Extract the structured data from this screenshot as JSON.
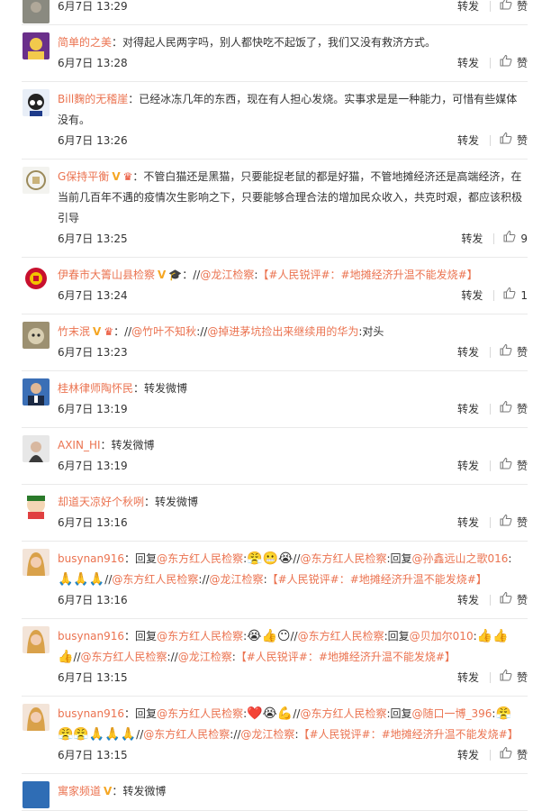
{
  "actions": {
    "repost": "转发",
    "like": "赞"
  },
  "comments": [
    {
      "user": "",
      "badges": [],
      "segments": [
        {
          "t": "text",
          "v": ""
        }
      ],
      "time": "6月7日 13:29",
      "likes": "赞",
      "avatar": "gray"
    },
    {
      "user": "简单的之美",
      "badges": [],
      "segments": [
        {
          "t": "text",
          "v": "：对得起人民两字吗，别人都快吃不起饭了，我们又没有救济方式。"
        }
      ],
      "time": "6月7日 13:28",
      "likes": "赞",
      "avatar": "purple"
    },
    {
      "user": "Bill麴的无稽崖",
      "badges": [],
      "segments": [
        {
          "t": "text",
          "v": "：已经冰冻几年的东西，现在有人担心发烧。实事求是是一种能力，可惜有些媒体没有。"
        }
      ],
      "time": "6月7日 13:26",
      "likes": "赞",
      "avatar": "anime"
    },
    {
      "user": "G保持平衡",
      "badges": [
        "V",
        "vip"
      ],
      "segments": [
        {
          "t": "text",
          "v": "：不管白猫还是黑猫，只要能捉老鼠的都是好猫，不管地摊经济还是高端经济，在当前几百年不遇的疫情次生影响之下，只要能够合理合法的增加民众收入，共克时艰，都应该积极引导"
        }
      ],
      "time": "6月7日 13:25",
      "likes": "9",
      "avatar": "logo"
    },
    {
      "user": "伊春市大箐山县检察",
      "badges": [
        "V",
        "grad"
      ],
      "segments": [
        {
          "t": "text",
          "v": "：//"
        },
        {
          "t": "link",
          "v": "@龙江检察"
        },
        {
          "t": "text",
          "v": ":"
        },
        {
          "t": "link",
          "v": "【#人民锐评#：#地摊经济升温不能发烧#】"
        }
      ],
      "time": "6月7日 13:24",
      "likes": "1",
      "avatar": "emblem"
    },
    {
      "user": "竹末泯",
      "badges": [
        "V",
        "vip"
      ],
      "segments": [
        {
          "t": "text",
          "v": "：//"
        },
        {
          "t": "link",
          "v": "@竹叶不知秋"
        },
        {
          "t": "text",
          "v": "://"
        },
        {
          "t": "link",
          "v": "@掉进茅坑捡出来继续用的华为"
        },
        {
          "t": "text",
          "v": ":对头"
        }
      ],
      "time": "6月7日 13:23",
      "likes": "赞",
      "avatar": "cat"
    },
    {
      "user": "桂林律师陶怀民",
      "badges": [],
      "segments": [
        {
          "t": "text",
          "v": "：转发微博"
        }
      ],
      "time": "6月7日 13:19",
      "likes": "赞",
      "avatar": "man"
    },
    {
      "user": "AXIN_HI",
      "badges": [],
      "segments": [
        {
          "t": "text",
          "v": "：转发微博"
        }
      ],
      "time": "6月7日 13:19",
      "likes": "赞",
      "avatar": "girl"
    },
    {
      "user": "却道天凉好个秋咧",
      "badges": [],
      "segments": [
        {
          "t": "text",
          "v": "：转发微博"
        }
      ],
      "time": "6月7日 13:16",
      "likes": "赞",
      "avatar": "cartoon"
    },
    {
      "user": "busynan916",
      "badges": [],
      "segments": [
        {
          "t": "text",
          "v": "：回复"
        },
        {
          "t": "link",
          "v": "@东方红人民检察"
        },
        {
          "t": "text",
          "v": ":"
        },
        {
          "t": "emo",
          "v": "😤😬😭"
        },
        {
          "t": "text",
          "v": "//"
        },
        {
          "t": "link",
          "v": "@东方红人民检察"
        },
        {
          "t": "text",
          "v": ":回复"
        },
        {
          "t": "link",
          "v": "@孙鑫远山之歌016"
        },
        {
          "t": "text",
          "v": ":"
        },
        {
          "t": "emo",
          "v": "🙏🙏🙏"
        },
        {
          "t": "text",
          "v": "//"
        },
        {
          "t": "link",
          "v": "@东方红人民检察"
        },
        {
          "t": "text",
          "v": "://"
        },
        {
          "t": "link",
          "v": "@龙江检察"
        },
        {
          "t": "text",
          "v": ":"
        },
        {
          "t": "link",
          "v": "【#人民锐评#：#地摊经济升温不能发烧#】"
        }
      ],
      "time": "6月7日 13:16",
      "likes": "赞",
      "avatar": "woman"
    },
    {
      "user": "busynan916",
      "badges": [],
      "segments": [
        {
          "t": "text",
          "v": "：回复"
        },
        {
          "t": "link",
          "v": "@东方红人民检察"
        },
        {
          "t": "text",
          "v": ":"
        },
        {
          "t": "emo",
          "v": "😭👍😶"
        },
        {
          "t": "text",
          "v": "//"
        },
        {
          "t": "link",
          "v": "@东方红人民检察"
        },
        {
          "t": "text",
          "v": ":回复"
        },
        {
          "t": "link",
          "v": "@贝加尔010"
        },
        {
          "t": "text",
          "v": ":"
        },
        {
          "t": "emo",
          "v": "👍👍👍"
        },
        {
          "t": "text",
          "v": "//"
        },
        {
          "t": "link",
          "v": "@东方红人民检察"
        },
        {
          "t": "text",
          "v": "://"
        },
        {
          "t": "link",
          "v": "@龙江检察"
        },
        {
          "t": "text",
          "v": ":"
        },
        {
          "t": "link",
          "v": "【#人民锐评#：#地摊经济升温不能发烧#】"
        }
      ],
      "time": "6月7日 13:15",
      "likes": "赞",
      "avatar": "woman"
    },
    {
      "user": "busynan916",
      "badges": [],
      "segments": [
        {
          "t": "text",
          "v": "：回复"
        },
        {
          "t": "link",
          "v": "@东方红人民检察"
        },
        {
          "t": "text",
          "v": ":"
        },
        {
          "t": "emo",
          "v": "❤️😭💪"
        },
        {
          "t": "text",
          "v": "//"
        },
        {
          "t": "link",
          "v": "@东方红人民检察"
        },
        {
          "t": "text",
          "v": ":回复"
        },
        {
          "t": "link",
          "v": "@随口一博_396"
        },
        {
          "t": "text",
          "v": ":"
        },
        {
          "t": "emo",
          "v": "😤😤😤🙏🙏🙏"
        },
        {
          "t": "text",
          "v": "//"
        },
        {
          "t": "link",
          "v": "@东方红人民检察"
        },
        {
          "t": "text",
          "v": "://"
        },
        {
          "t": "link",
          "v": "@龙江检察"
        },
        {
          "t": "text",
          "v": ":"
        },
        {
          "t": "link",
          "v": "【#人民锐评#：#地摊经济升温不能发烧#】"
        }
      ],
      "time": "6月7日 13:15",
      "likes": "赞",
      "avatar": "woman"
    },
    {
      "user": "寓家频道",
      "badges": [
        "V"
      ],
      "segments": [
        {
          "t": "text",
          "v": "：转发微博"
        }
      ],
      "time": "",
      "likes": "",
      "avatar": "blue"
    }
  ]
}
